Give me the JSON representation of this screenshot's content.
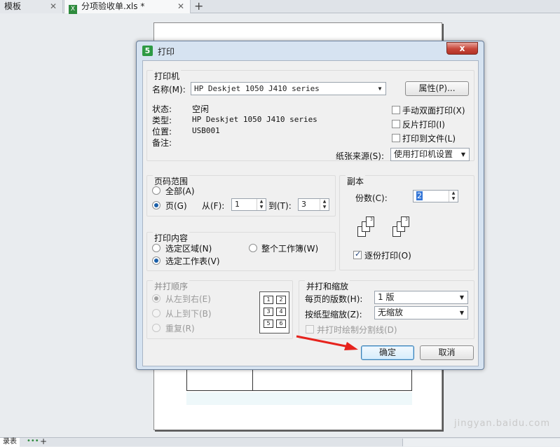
{
  "tabs": [
    {
      "label": "模板"
    },
    {
      "label": "分项验收单.xls *"
    }
  ],
  "bottom": {
    "sheet_label": "录表"
  },
  "watermark": "jingyan.baidu.com",
  "dialog": {
    "title": "打印",
    "close": "x",
    "printer": {
      "group_label": "打印机",
      "name_label": "名称(M):",
      "name_value": "HP Deskjet 1050 J410 series",
      "properties_button": "属性(P)...",
      "status_label": "状态:",
      "status_value": "空闲",
      "type_label": "类型:",
      "type_value": "HP Deskjet 1050 J410 series",
      "location_label": "位置:",
      "location_value": "USB001",
      "comment_label": "备注:",
      "duplex_label": "手动双面打印(X)",
      "reverse_label": "反片打印(I)",
      "tofile_label": "打印到文件(L)",
      "source_label": "纸张来源(S):",
      "source_value": "使用打印机设置"
    },
    "page_range": {
      "group_label": "页码范围",
      "all_label": "全部(A)",
      "pages_label": "页(G)",
      "from_label": "从(F):",
      "from_value": "1",
      "to_label": "到(T):",
      "to_value": "3"
    },
    "copies": {
      "group_label": "副本",
      "count_label": "份数(C):",
      "count_value": "2",
      "collate_label": "逐份打印(O)",
      "collate_checked": true
    },
    "content": {
      "group_label": "打印内容",
      "selection_label": "选定区域(N)",
      "workbook_label": "整个工作簿(W)",
      "sheet_label": "选定工作表(V)"
    },
    "order": {
      "group_label": "并打顺序",
      "ltr_label": "从左到右(E)",
      "ttb_label": "从上到下(B)",
      "repeat_label": "重复(R)",
      "grid": [
        "1",
        "2",
        "3",
        "4",
        "5",
        "6"
      ]
    },
    "zoom": {
      "group_label": "并打和缩放",
      "pages_per_sheet_label": "每页的版数(H):",
      "pages_per_sheet_value": "1 版",
      "scale_label": "按纸型缩放(Z):",
      "scale_value": "无缩放",
      "divider_label": "并打时绘制分割线(D)"
    },
    "ok_button": "确定",
    "cancel_button": "取消"
  }
}
